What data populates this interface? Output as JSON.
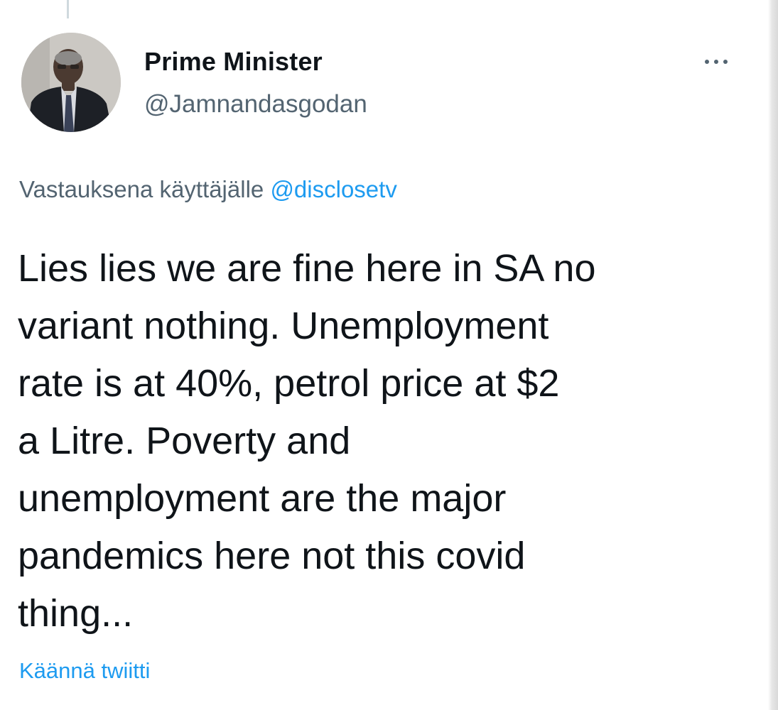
{
  "author": {
    "display_name": "Prime Minister",
    "handle": "@Jamnandasgodan",
    "avatar_icon": "profile-photo"
  },
  "menu": {
    "icon": "more-horizontal-icon"
  },
  "reply_context": {
    "prefix": "Vastauksena käyttäjälle ",
    "mention": "@disclosetv"
  },
  "tweet": {
    "text": "Lies lies we are fine here in SA no\nvariant nothing. Unemployment\nrate is at 40%, petrol price at $2\na Litre. Poverty and\nunemployment are the major\npandemics here not this covid\nthing..."
  },
  "translate": {
    "label": "Käännä twiitti"
  },
  "colors": {
    "text_primary": "#0f1419",
    "text_secondary": "#536471",
    "link": "#1d9bf0"
  }
}
